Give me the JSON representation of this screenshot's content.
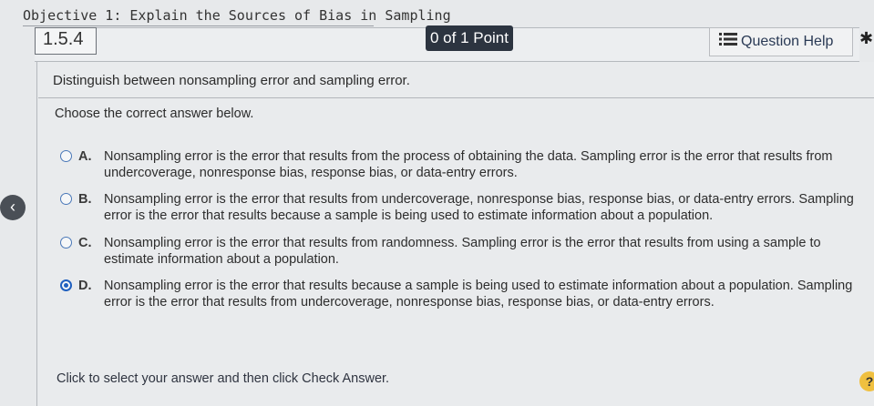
{
  "objective": "Objective 1: Explain the Sources of Bias in Sampling",
  "question_number": "1.5.4",
  "points": "0 of 1 Point",
  "help_label": "Question Help",
  "prompt": "Distinguish between nonsampling error and sampling error.",
  "instruction": "Choose the correct answer below.",
  "options": [
    {
      "letter": "A.",
      "text": "Nonsampling error is the error that results from the process of obtaining the data. Sampling error is the error that results from undercoverage, nonresponse bias, response bias, or data-entry errors.",
      "selected": false
    },
    {
      "letter": "B.",
      "text": "Nonsampling error is the error that results from undercoverage, nonresponse bias, response bias, or data-entry errors. Sampling error is the error that results because a sample is being used to estimate information about a population.",
      "selected": false
    },
    {
      "letter": "C.",
      "text": "Nonsampling error is the error that results from randomness. Sampling error is the error that results from using a sample to estimate information about a population.",
      "selected": false
    },
    {
      "letter": "D.",
      "text": "Nonsampling error is the error that results because a sample is being used to estimate information about a population. Sampling error is the error that results from undercoverage, nonresponse bias, response bias, or data-entry errors.",
      "selected": true
    }
  ],
  "footer": "Click to select your answer and then click Check Answer.",
  "icons": {
    "help": "list-icon",
    "settings": "gear-icon",
    "back": "chevron-left-icon",
    "hint": "question-mark-icon"
  }
}
